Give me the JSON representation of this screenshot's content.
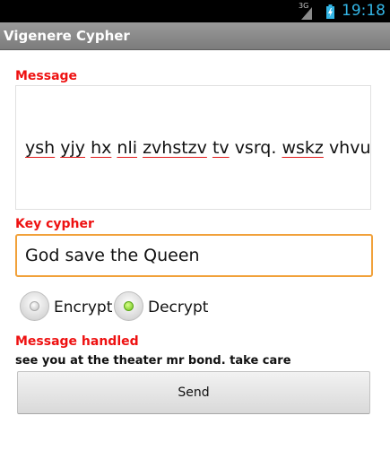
{
  "status_bar": {
    "network": "3G",
    "time": "19:18",
    "icons": [
      "signal-icon",
      "battery-charging-icon"
    ]
  },
  "app": {
    "title": "Vigenere Cypher"
  },
  "form": {
    "message_label": "Message",
    "message_words": [
      "ysh",
      "yjy",
      "hx",
      "nli",
      "zvhstzv",
      "tv",
      "vsrq.",
      "wskz",
      "vhvu"
    ],
    "message_underlined": [
      true,
      true,
      true,
      true,
      true,
      true,
      false,
      true,
      false
    ],
    "key_label": "Key cypher",
    "key_value": "God save the Queen",
    "mode_options": [
      {
        "label": "Encrypt",
        "selected": false
      },
      {
        "label": "Decrypt",
        "selected": true
      }
    ],
    "result_label": "Message handled",
    "result_value": "see you at the theater mr bond. take care",
    "send_label": "Send"
  },
  "colors": {
    "accent_label": "#ee1111",
    "focus_border": "#f1a13a",
    "clock": "#33b5e5",
    "radio_selected": "#6cc21a"
  }
}
